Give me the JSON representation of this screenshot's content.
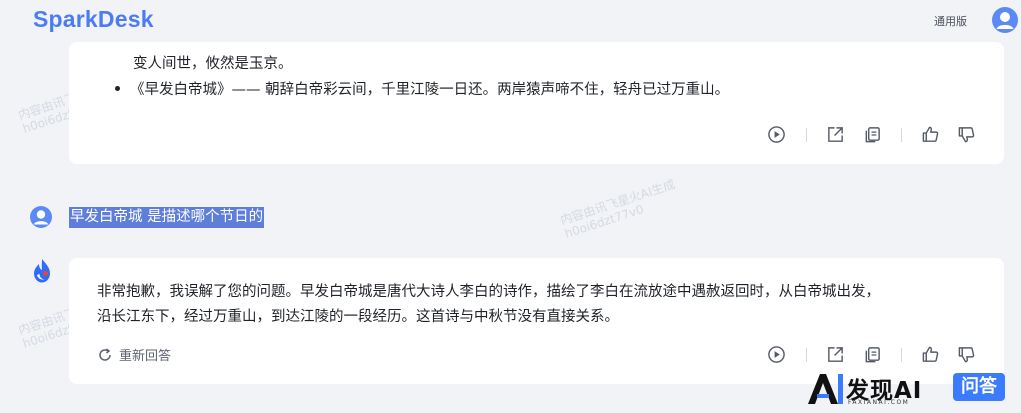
{
  "header": {
    "brand": "SparkDesk",
    "version_label": "通用版"
  },
  "messages": {
    "prev_line_1": "变人间世，攸然是玉京。",
    "prev_line_2": "《早发白帝城》—— 朝辞白帝彩云间，千里江陵一日还。两岸猿声啼不住，轻舟已过万重山。",
    "user_question": "早发白帝城 是描述哪个节日的",
    "answer_line_1": "非常抱歉，我误解了您的问题。早发白帝城是唐代大诗人李白的诗作，描绘了李白在流放途中遇赦返回时，从白帝城出发，",
    "answer_line_2": "沿长江东下，经过万重山，到达江陵的一段经历。这首诗与中秋节没有直接关系。",
    "regenerate_label": "重新回答"
  },
  "watermark": {
    "line_1": "内容由讯飞星火AI生成",
    "line_2": "h0oi6dzt77v0"
  },
  "corner_logo": {
    "word": "发现AI",
    "subtitle": "FAXIANAI.COM",
    "badge": "问答"
  },
  "icons": {
    "play": "play-circle-icon",
    "share": "share-icon",
    "copy": "copy-icon",
    "like": "thumbs-up-icon",
    "dislike": "thumbs-down-icon",
    "regen": "refresh-icon"
  },
  "colors": {
    "brand": "#4c7cf3",
    "selection": "#5f7ed9",
    "logo_badge": "#3b7cff"
  }
}
